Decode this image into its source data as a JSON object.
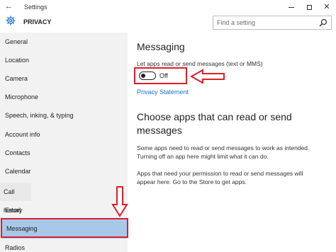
{
  "window": {
    "title": "Settings",
    "back_glyph": "←",
    "minimize_glyph": "",
    "close_glyph": "✕"
  },
  "header": {
    "title": "PRIVACY",
    "icon": "gear-icon"
  },
  "search": {
    "placeholder": "Find a setting",
    "icon": "search-icon"
  },
  "sidebar": {
    "items": [
      {
        "label": "General"
      },
      {
        "label": "Location"
      },
      {
        "label": "Camera"
      },
      {
        "label": "Microphone"
      },
      {
        "label": "Speech, inking, & typing"
      },
      {
        "label": "Account info"
      },
      {
        "label": "Contacts"
      },
      {
        "label": "Calendar"
      },
      {
        "label": "Call history"
      },
      {
        "label": "Email"
      },
      {
        "label": "Messaging"
      },
      {
        "label": "Radios"
      }
    ],
    "selected": "Messaging"
  },
  "main": {
    "section1_title": "Messaging",
    "toggle_desc": "Let apps read or send messages (text or MMS)",
    "toggle_state": "Off",
    "privacy_link": "Privacy Statement",
    "section2_title_line1": "Choose apps that can read or send",
    "section2_title_line2": "messages",
    "para1_line1": "Some apps need to read or send messages to work as intended.",
    "para1_line2": "Turning off an app here might limit what it can do.",
    "para2_line1": "Apps that need your permission to read or send messages will",
    "para2_line2": "appear here. Go to the Store to get apps."
  },
  "colors": {
    "selected_bg": "#a8c8ea",
    "sidebar_bg": "#f2f2f2",
    "annotation_red": "#d9202c",
    "link": "#1a73c7"
  }
}
